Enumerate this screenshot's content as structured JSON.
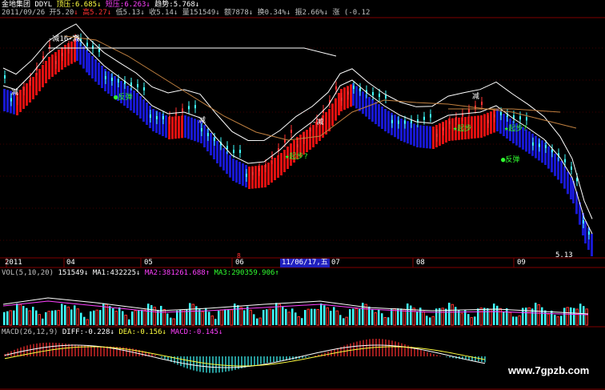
{
  "header": {
    "stock_name": "金地集团",
    "indicator": "DDYL",
    "resistance_label": "顶压:",
    "resistance_value": "6.685",
    "short_pressure_label": "短压:",
    "short_pressure_value": "6.263",
    "trend_label": "趋势:",
    "trend_value": "5.768",
    "date": "2011/09/26",
    "open": "开5.20",
    "high": "高5.27",
    "low": "低5.13",
    "close": "收5.14",
    "volume": "量151549",
    "amount": "额7878",
    "turnover": "换0.34%",
    "amplitude": "振2.66%",
    "change": "涨 (-0.12"
  },
  "main_chart": {
    "annotations": {
      "sell_top": "-减16-减",
      "rebound_1": "反弹",
      "reduce_1": "减",
      "start_1": "起步?",
      "reduce_2": "-减",
      "reduce_3": "减",
      "start_2": "起步",
      "start_3": "起步?",
      "rebound_2": "反弹",
      "reduce_4": "减"
    },
    "last_price": "5.13",
    "x_axis": {
      "labels": [
        "2011",
        "04",
        "05",
        "06",
        "07",
        "08",
        "09"
      ],
      "cursor_date": "11/06/17,五",
      "red_marker": "8"
    }
  },
  "volume_panel": {
    "title": "VOL(5,10,20)",
    "vol": "151549",
    "ma1": "MA1:432225",
    "ma2": "MA2:381261.688",
    "ma3": "MA3:290359.906"
  },
  "macd_panel": {
    "title": "MACD(26,12,9)",
    "diff": "DIFF:-0.228",
    "dea": "DEA:-0.156",
    "macd": "MACD:-0.145"
  },
  "watermark": "www.7gpzb.com",
  "colors": {
    "up": "#ff3030",
    "down": "#40ffff",
    "band_up": "#e01010",
    "band_down": "#1818d0",
    "grid": "#800000"
  }
}
